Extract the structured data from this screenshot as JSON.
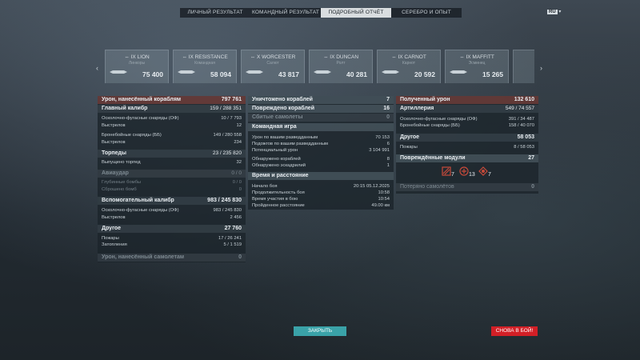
{
  "tabs": [
    "ЛИЧНЫЙ РЕЗУЛЬТАТ",
    "КОМАНДНЫЙ РЕЗУЛЬТАТ",
    "ПОДРОБНЫЙ ОТЧЁТ",
    "СЕРЕБРО И ОПЫТ"
  ],
  "lang": "RU",
  "ships": [
    {
      "name": "IX LION",
      "sub": "Линкоры",
      "value": "75 400"
    },
    {
      "name": "IX RESISTANCE",
      "sub": "Командная",
      "value": "58 094"
    },
    {
      "name": "X WORCESTER",
      "sub": "Салют",
      "value": "43 817"
    },
    {
      "name": "IX DUNCAN",
      "sub": "Ролт",
      "value": "40 281"
    },
    {
      "name": "IX CARNOT",
      "sub": "Карнот",
      "value": "20 592"
    },
    {
      "name": "IX MAFFITT",
      "sub": "Эсминец",
      "value": "15 265"
    }
  ],
  "left": {
    "dmg_title": "Урон, нанесённый кораблям",
    "dmg_total": "797 761",
    "main_title": "Главный калибр",
    "main_val": "159 / 288 351",
    "he_label": "Осколочно-фугасные снаряды (ОФ)",
    "he_val": "10 / 7 793",
    "shots_label": "Выстрелов",
    "shots_val": "12",
    "ap_label": "Бронебойные снаряды (ББ)",
    "ap_val": "149 / 280 558",
    "ap_shots_label": "Выстрелов",
    "ap_shots_val": "234",
    "torp_title": "Торпеды",
    "torp_val": "23 / 235 820",
    "torp_label": "Выпущено торпед",
    "torp_count": "32",
    "air_title": "Авиаудар",
    "air_val": "0 / 0",
    "depth_label": "Глубинные бомбы",
    "depth_val": "0 / 0",
    "dropped_label": "Сброшено бомб",
    "dropped_val": "0",
    "sec_title": "Вспомогательный калибр",
    "sec_val": "983 / 245 830",
    "sec_he_label": "Осколочно-фугасные снаряды (ОФ)",
    "sec_he_val": "983 / 245 830",
    "sec_shots_label": "Выстрелов",
    "sec_shots_val": "2 456",
    "other_title": "Другое",
    "other_val": "27 760",
    "fire_label": "Пожары",
    "fire_val": "17 / 26 241",
    "flood_label": "Затопления",
    "flood_val": "5 / 1 519",
    "planes_title": "Урон, нанесённый самолетам",
    "planes_val": "0"
  },
  "middle": {
    "killed_label": "Уничтожено кораблей",
    "killed_val": "7",
    "damaged_label": "Повреждено кораблей",
    "damaged_val": "16",
    "planes_label": "Сбитые самолеты",
    "planes_val": "0",
    "team_title": "Командная игра",
    "spot_dmg_label": "Урон по вашим разведданным",
    "spot_dmg_val": "70 153",
    "spot_burn_label": "Подожгов по вашим разведданным",
    "spot_burn_val": "6",
    "potential_label": "Потенциальный урон",
    "potential_val": "3 104 991",
    "ships_spotted_label": "Обнаружено кораблей",
    "ships_spotted_val": "8",
    "sq_spotted_label": "Обнаружено эскадрилий",
    "sq_spotted_val": "1",
    "time_title": "Время и расстояние",
    "start_label": "Начало боя",
    "start_val": "20:15 05.12.2025",
    "duration_label": "Продолжительность боя",
    "duration_val": "10:58",
    "participation_label": "Время участия в бою",
    "participation_val": "10:54",
    "distance_label": "Пройденное расстояние",
    "distance_val": "49.00 км"
  },
  "right": {
    "recv_title": "Полученный урон",
    "recv_val": "132 610",
    "art_title": "Артиллерия",
    "art_val": "549 / 74 557",
    "r_he_label": "Осколочно-фугасные снаряды (ОФ)",
    "r_he_val": "391 / 34 487",
    "r_ap_label": "Бронебойные снаряды (ББ)",
    "r_ap_val": "158 / 40 070",
    "r_other_title": "Другое",
    "r_other_val": "58 053",
    "r_fire_label": "Пожары",
    "r_fire_val": "8 / 58 053",
    "mod_title": "Повреждённые модули",
    "mod_val": "27",
    "mod_counts": [
      "7",
      "13",
      "7"
    ],
    "lost_planes_label": "Потеряно самолётов",
    "lost_planes_val": "0"
  },
  "buttons": {
    "close": "ЗАКРЫТЬ",
    "battle": "СНОВА В БОЙ!"
  },
  "colors": {
    "accent": "#3aa2a8",
    "battle": "#d21f26"
  }
}
